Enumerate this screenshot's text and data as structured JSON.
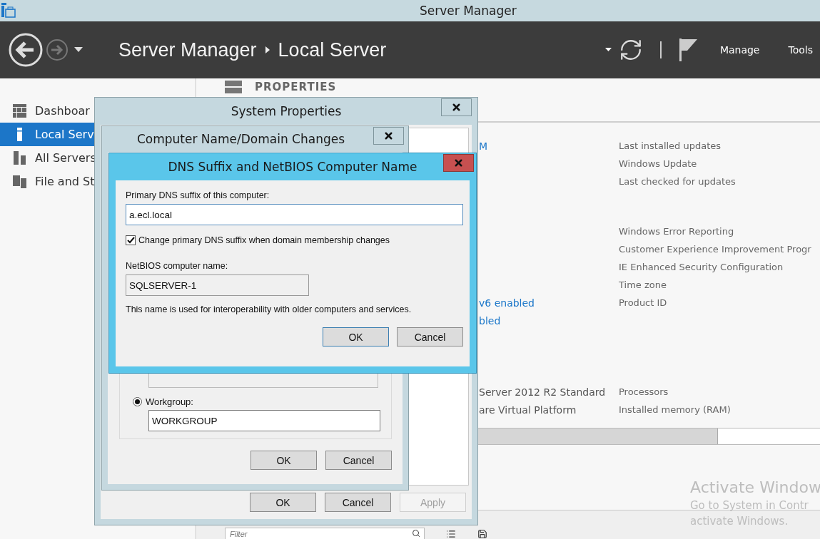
{
  "window": {
    "title": "Server Manager"
  },
  "header": {
    "breadcrumb": [
      "Server Manager",
      "Local Server"
    ],
    "menu": [
      "Manage",
      "Tools"
    ]
  },
  "sidebar": {
    "items": [
      {
        "label": "Dashboar",
        "kind": "dashboard",
        "selected": false
      },
      {
        "label": "Local Serv",
        "kind": "server",
        "selected": true
      },
      {
        "label": "All Servers",
        "kind": "servers",
        "selected": false
      },
      {
        "label": "File and St",
        "kind": "files",
        "selected": false
      }
    ]
  },
  "properties": {
    "heading": "PROPERTIES",
    "groups": [
      [
        {
          "value": "M",
          "kind": "link",
          "label": "Last installed updates"
        },
        {
          "label": "Windows Update"
        },
        {
          "label": "Last checked for updates"
        }
      ],
      [
        {
          "label": "Windows Error Reporting"
        },
        {
          "label": "Customer Experience Improvement Progr"
        },
        {
          "label": "IE Enhanced Security Configuration"
        },
        {
          "label": "Time zone"
        },
        {
          "value": "v6 enabled",
          "kind": "link",
          "label": "Product ID"
        },
        {
          "value": "bled",
          "kind": "link"
        }
      ],
      [
        {
          "value": "Server 2012 R2 Standard",
          "kind": "text",
          "label": "Processors"
        },
        {
          "value": "are Virtual Platform",
          "kind": "text",
          "label": "Installed memory (RAM)"
        }
      ]
    ]
  },
  "filter": {
    "placeholder": "Filter"
  },
  "activation": {
    "title": "Activate Window",
    "lines": [
      "Go to System in Contr",
      "activate Windows."
    ]
  },
  "dialogs": {
    "system_properties": {
      "title": "System Properties",
      "buttons": [
        {
          "label": "OK",
          "disabled": false,
          "default": false
        },
        {
          "label": "Cancel",
          "disabled": false,
          "default": false
        },
        {
          "label": "Apply",
          "disabled": true,
          "default": false
        }
      ]
    },
    "computer_name": {
      "title": "Computer Name/Domain Changes",
      "options": [
        {
          "label": "Workgroup:",
          "selected": true,
          "value": "WORKGROUP"
        }
      ],
      "buttons": [
        {
          "label": "OK",
          "disabled": false,
          "default": false
        },
        {
          "label": "Cancel",
          "disabled": false,
          "default": false
        }
      ]
    },
    "dns": {
      "title": "DNS Suffix and NetBIOS Computer Name",
      "suffix_label": "Primary DNS suffix of this computer:",
      "suffix_value": "a.ecl.local",
      "change_option": {
        "label": "Change primary DNS suffix when domain membership changes",
        "checked": true
      },
      "netbios_label": "NetBIOS computer name:",
      "netbios_value": "SQLSERVER-1",
      "netbios_read_only": true,
      "note": "This name is used for interoperability with older computers and services.",
      "buttons": [
        {
          "label": "OK",
          "disabled": false,
          "default": true
        },
        {
          "label": "Cancel",
          "disabled": false,
          "default": false
        }
      ]
    }
  }
}
